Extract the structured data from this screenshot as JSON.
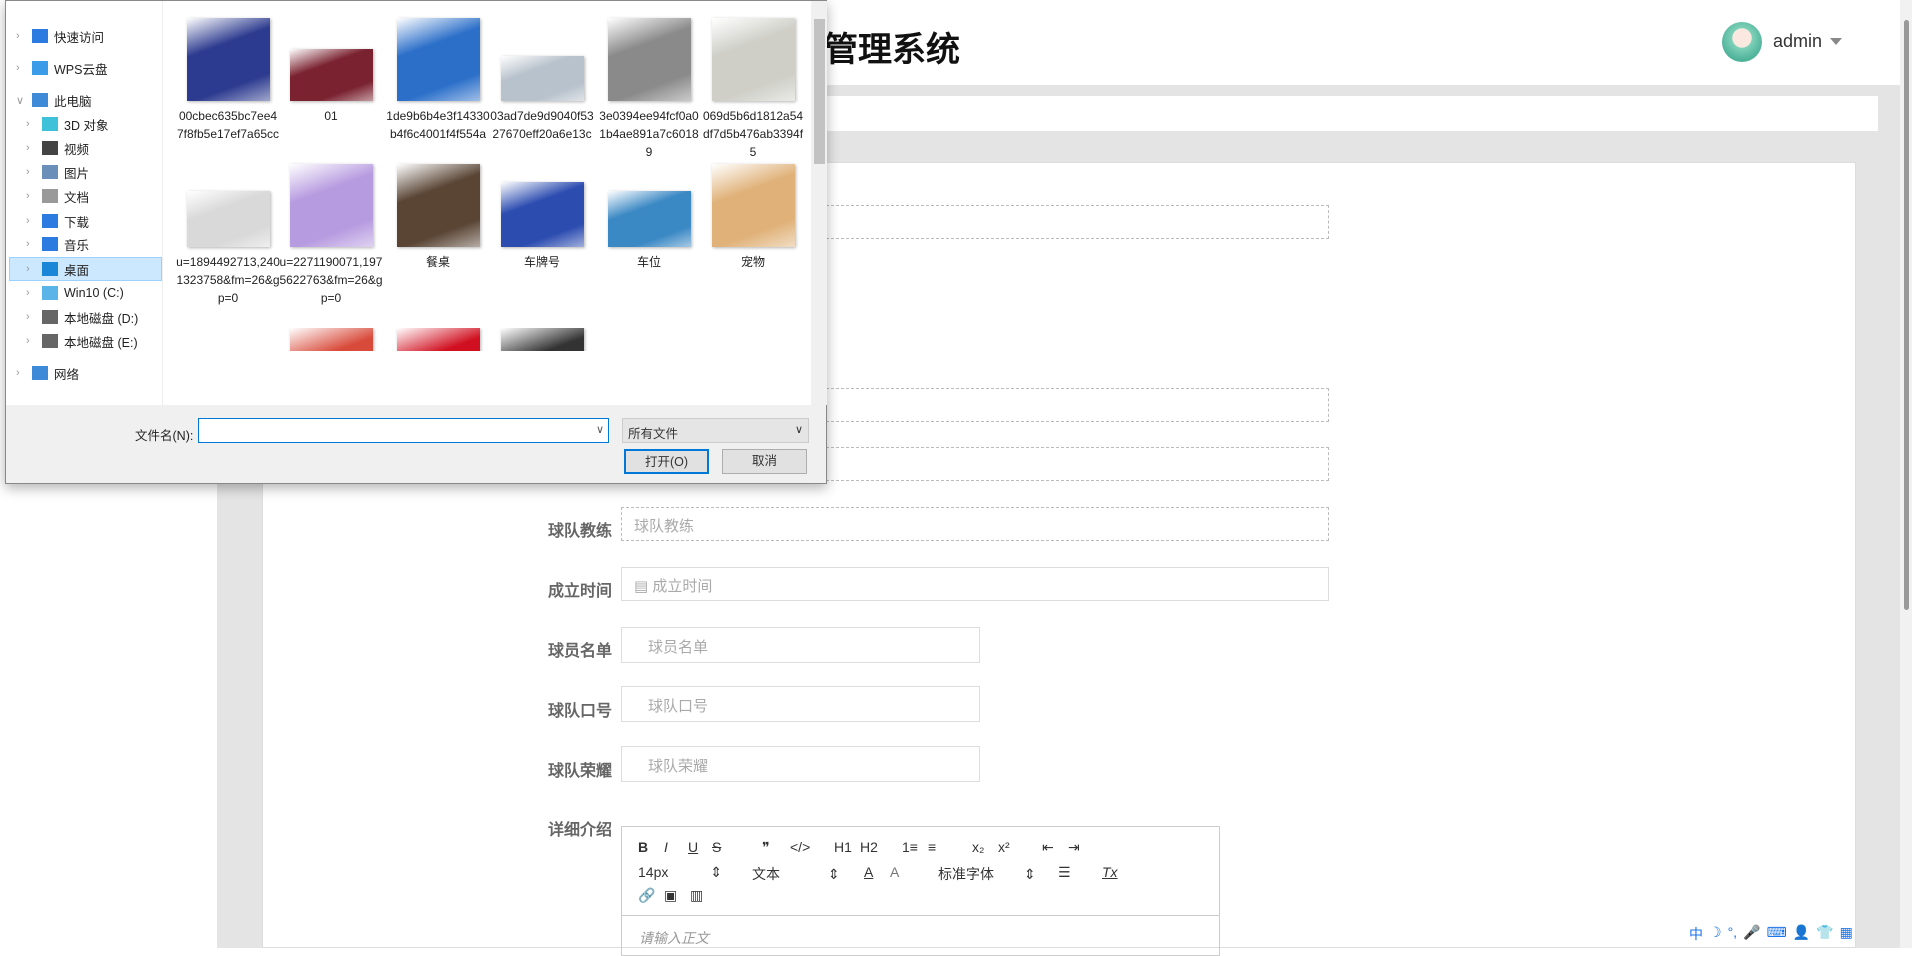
{
  "header": {
    "title": "管理系统",
    "user": "admin"
  },
  "form": {
    "rows": [
      {
        "label": "球队教练",
        "placeholder": "球队教练"
      },
      {
        "label": "成立时间",
        "placeholder": "成立时间"
      },
      {
        "label": "球员名单",
        "placeholder": "球员名单"
      },
      {
        "label": "球队口号",
        "placeholder": "球队口号"
      },
      {
        "label": "球队荣耀",
        "placeholder": "球队荣耀"
      }
    ],
    "intro_label": "详细介绍",
    "editor": {
      "toolbar1": [
        "B",
        "I",
        "U",
        "S",
        "❞",
        "</>",
        "H1",
        "H2",
        "1≡",
        "≡",
        "x₂",
        "x²",
        "⇤",
        "⇥"
      ],
      "font_size": "14px",
      "header": "文本",
      "font": "标准字体",
      "placeholder": "请输入正文"
    }
  },
  "dialog": {
    "nav": [
      "快速访问",
      "WPS云盘",
      "此电脑",
      "3D 对象",
      "视频",
      "图片",
      "文档",
      "下载",
      "音乐",
      "桌面",
      "Win10 (C:)",
      "本地磁盘 (D:)",
      "本地磁盘 (E:)",
      "网络"
    ],
    "files": [
      {
        "name": "00cbec635bc7ee47f8fb5e17ef7a65cc",
        "color": "#2c3a8f"
      },
      {
        "name": "01",
        "color": "#7a2230"
      },
      {
        "name": "1de9b6b4e3f14330b4f6c4001f4f554a",
        "color": "#2b6fc9"
      },
      {
        "name": "03ad7de9d9040f5327670eff20a6e13c",
        "color": "#b8c2cc"
      },
      {
        "name": "3e0394ee94fcf0a01b4ae891a7c60189",
        "color": "#8a8a8a"
      },
      {
        "name": "069d5b6d1812a54df7d5b476ab3394f5",
        "color": "#cfcfc8"
      },
      {
        "name": "u=1894492713,2401323758&fm=26&gp=0",
        "color": "#d9d9d9"
      },
      {
        "name": "u=2271190071,1975622763&fm=26&gp=0",
        "color": "#b79be0"
      },
      {
        "name": "餐桌",
        "color": "#5a4535"
      },
      {
        "name": "车牌号",
        "color": "#2c4cb0"
      },
      {
        "name": "车位",
        "color": "#3a88c4"
      },
      {
        "name": "宠物",
        "color": "#e0b27a"
      },
      {
        "name": "",
        "color": "#5e8a3a"
      },
      {
        "name": "",
        "color": "#d84a3a"
      },
      {
        "name": "",
        "color": "#d01020"
      },
      {
        "name": "",
        "color": "#333333"
      },
      {
        "name": "",
        "color": "#6a5548"
      },
      {
        "name": "",
        "color": "#7aa4d4"
      }
    ],
    "filename_label": "文件名(N):",
    "filename_value": "",
    "filter": "所有文件",
    "open": "打开(O)",
    "cancel": "取消"
  },
  "ime": [
    "中",
    "☽",
    "°,",
    "🎤",
    "⌨",
    "👤",
    "👕",
    "▦"
  ]
}
